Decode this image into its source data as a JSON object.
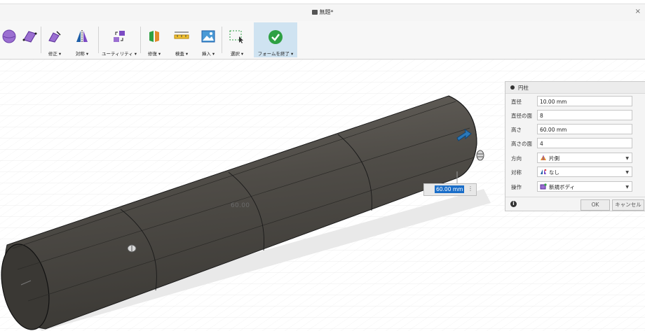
{
  "window": {
    "title": "無題*"
  },
  "toolbar": {
    "tools": [
      {
        "id": "sphere",
        "label": ""
      },
      {
        "id": "plane",
        "label": ""
      },
      {
        "id": "modify",
        "label": "修正 ▾"
      },
      {
        "id": "symmetry",
        "label": "対称 ▾"
      },
      {
        "id": "utility",
        "label": "ユーティリティ ▾"
      },
      {
        "id": "repair",
        "label": "修復 ▾"
      },
      {
        "id": "inspect",
        "label": "検査 ▾"
      },
      {
        "id": "insert",
        "label": "挿入 ▾"
      },
      {
        "id": "select",
        "label": "選択 ▾"
      },
      {
        "id": "finish-form",
        "label": "フォームを終了 ▾"
      }
    ]
  },
  "viewport": {
    "dimension_label": "60.00",
    "dimension_input_value": "60.00 mm"
  },
  "panel": {
    "title": "円柱",
    "fields": [
      {
        "label": "直径",
        "value": "10.00 mm"
      },
      {
        "label": "直径の面",
        "value": "8"
      },
      {
        "label": "高さ",
        "value": "60.00 mm"
      },
      {
        "label": "高さの面",
        "value": "4"
      },
      {
        "label": "方向",
        "value": "片側"
      },
      {
        "label": "対称",
        "value": "なし"
      },
      {
        "label": "操作",
        "value": "新規ボディ"
      }
    ],
    "ok_label": "OK",
    "cancel_label": "キャンセル"
  },
  "colors": {
    "cylinder_body": "#54514c",
    "accent_blue": "#1a6ec9",
    "finish_green": "#2ea043",
    "toolbar_bg": "#f7f7f7"
  }
}
